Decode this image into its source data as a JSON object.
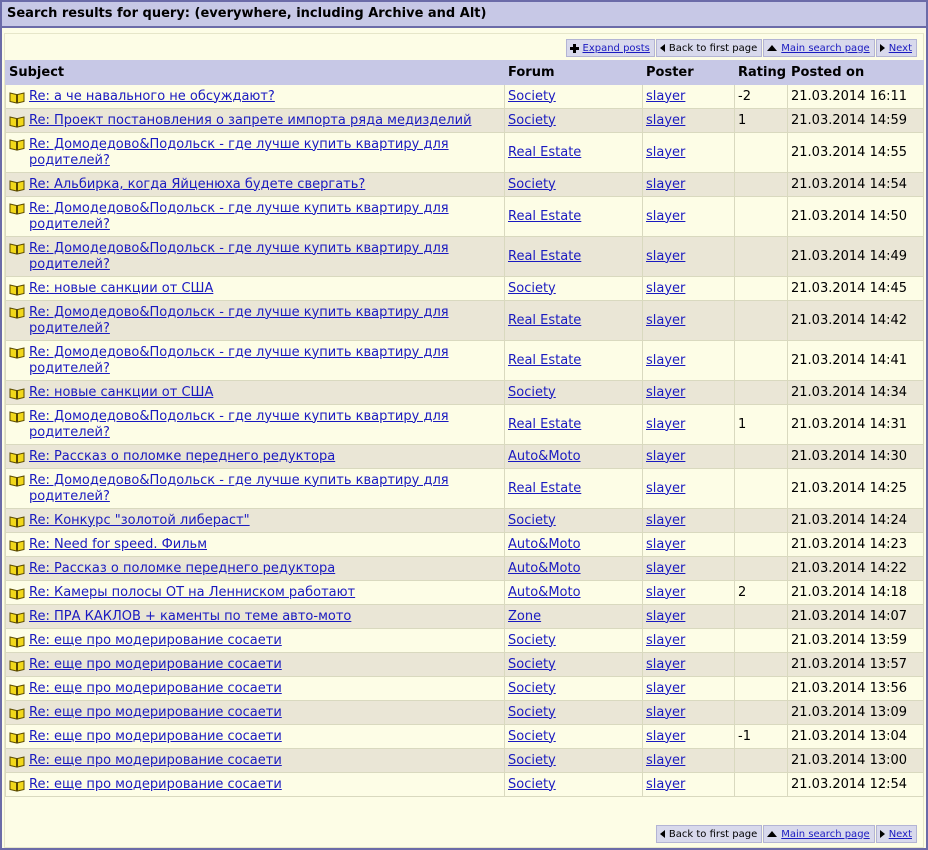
{
  "title": "Search results for query: (everywhere, including Archive and Alt)",
  "nav_top": {
    "expand": "Expand posts",
    "first": "Back to first page",
    "main": "Main search page",
    "next": "Next"
  },
  "nav_bottom": {
    "first": "Back to first page",
    "main": "Main search page",
    "next": "Next"
  },
  "columns": {
    "subject": "Subject",
    "forum": "Forum",
    "poster": "Poster",
    "rating": "Rating",
    "posted": "Posted on"
  },
  "icons": {
    "post": "open-book-icon",
    "expand": "plus-icon",
    "first": "arrow-left-icon",
    "main": "arrow-up-icon",
    "next": "arrow-right-icon"
  },
  "colors": {
    "header_bg": "#c7c8e6",
    "row_odd": "#fdfde6",
    "row_even": "#eae6d6",
    "link": "#1a1ac0",
    "border": "#6b6ba8"
  },
  "rows": [
    {
      "subject": "Re: а че навального не обсуждают?",
      "forum": "Society",
      "poster": "slayer",
      "rating": "-2",
      "posted": "21.03.2014 16:11"
    },
    {
      "subject": "Re: Проект постановления о запрете импорта ряда медизделий",
      "forum": "Society",
      "poster": "slayer",
      "rating": "1",
      "posted": "21.03.2014 14:59"
    },
    {
      "subject": "Re: Домодедово&Подольск - где лучше купить квартиру для родителей?",
      "forum": "Real Estate",
      "poster": "slayer",
      "rating": "",
      "posted": "21.03.2014 14:55"
    },
    {
      "subject": "Re: Альбирка, когда Яйценюха будете свергать?",
      "forum": "Society",
      "poster": "slayer",
      "rating": "",
      "posted": "21.03.2014 14:54"
    },
    {
      "subject": "Re: Домодедово&Подольск - где лучше купить квартиру для родителей?",
      "forum": "Real Estate",
      "poster": "slayer",
      "rating": "",
      "posted": "21.03.2014 14:50"
    },
    {
      "subject": "Re: Домодедово&Подольск - где лучше купить квартиру для родителей?",
      "forum": "Real Estate",
      "poster": "slayer",
      "rating": "",
      "posted": "21.03.2014 14:49"
    },
    {
      "subject": "Re: новые санкции от США",
      "forum": "Society",
      "poster": "slayer",
      "rating": "",
      "posted": "21.03.2014 14:45"
    },
    {
      "subject": "Re: Домодедово&Подольск - где лучше купить квартиру для родителей?",
      "forum": "Real Estate",
      "poster": "slayer",
      "rating": "",
      "posted": "21.03.2014 14:42"
    },
    {
      "subject": "Re: Домодедово&Подольск - где лучше купить квартиру для родителей?",
      "forum": "Real Estate",
      "poster": "slayer",
      "rating": "",
      "posted": "21.03.2014 14:41"
    },
    {
      "subject": "Re: новые санкции от США",
      "forum": "Society",
      "poster": "slayer",
      "rating": "",
      "posted": "21.03.2014 14:34"
    },
    {
      "subject": "Re: Домодедово&Подольск - где лучше купить квартиру для родителей?",
      "forum": "Real Estate",
      "poster": "slayer",
      "rating": "1",
      "posted": "21.03.2014 14:31"
    },
    {
      "subject": "Re: Рассказ о поломке переднего редуктора",
      "forum": "Auto&Moto",
      "poster": "slayer",
      "rating": "",
      "posted": "21.03.2014 14:30"
    },
    {
      "subject": "Re: Домодедово&Подольск - где лучше купить квартиру для родителей?",
      "forum": "Real Estate",
      "poster": "slayer",
      "rating": "",
      "posted": "21.03.2014 14:25"
    },
    {
      "subject": "Re: Конкурс \"золотой либераст\"",
      "forum": "Society",
      "poster": "slayer",
      "rating": "",
      "posted": "21.03.2014 14:24"
    },
    {
      "subject": "Re: Need for speed. Фильм",
      "forum": "Auto&Moto",
      "poster": "slayer",
      "rating": "",
      "posted": "21.03.2014 14:23"
    },
    {
      "subject": "Re: Рассказ о поломке переднего редуктора",
      "forum": "Auto&Moto",
      "poster": "slayer",
      "rating": "",
      "posted": "21.03.2014 14:22"
    },
    {
      "subject": "Re: Камеры полосы ОТ на Ленниском работают",
      "forum": "Auto&Moto",
      "poster": "slayer",
      "rating": "2",
      "posted": "21.03.2014 14:18"
    },
    {
      "subject": "Re: ПРА КАКЛОВ + каменты по теме авто-мото",
      "forum": "Zone",
      "poster": "slayer",
      "rating": "",
      "posted": "21.03.2014 14:07"
    },
    {
      "subject": "Re: еще про модерирование сосаети",
      "forum": "Society",
      "poster": "slayer",
      "rating": "",
      "posted": "21.03.2014 13:59"
    },
    {
      "subject": "Re: еще про модерирование сосаети",
      "forum": "Society",
      "poster": "slayer",
      "rating": "",
      "posted": "21.03.2014 13:57"
    },
    {
      "subject": "Re: еще про модерирование сосаети",
      "forum": "Society",
      "poster": "slayer",
      "rating": "",
      "posted": "21.03.2014 13:56"
    },
    {
      "subject": "Re: еще про модерирование сосаети",
      "forum": "Society",
      "poster": "slayer",
      "rating": "",
      "posted": "21.03.2014 13:09"
    },
    {
      "subject": "Re: еще про модерирование сосаети",
      "forum": "Society",
      "poster": "slayer",
      "rating": "-1",
      "posted": "21.03.2014 13:04"
    },
    {
      "subject": "Re: еще про модерирование сосаети",
      "forum": "Society",
      "poster": "slayer",
      "rating": "",
      "posted": "21.03.2014 13:00"
    },
    {
      "subject": "Re: еще про модерирование сосаети",
      "forum": "Society",
      "poster": "slayer",
      "rating": "",
      "posted": "21.03.2014 12:54"
    }
  ]
}
